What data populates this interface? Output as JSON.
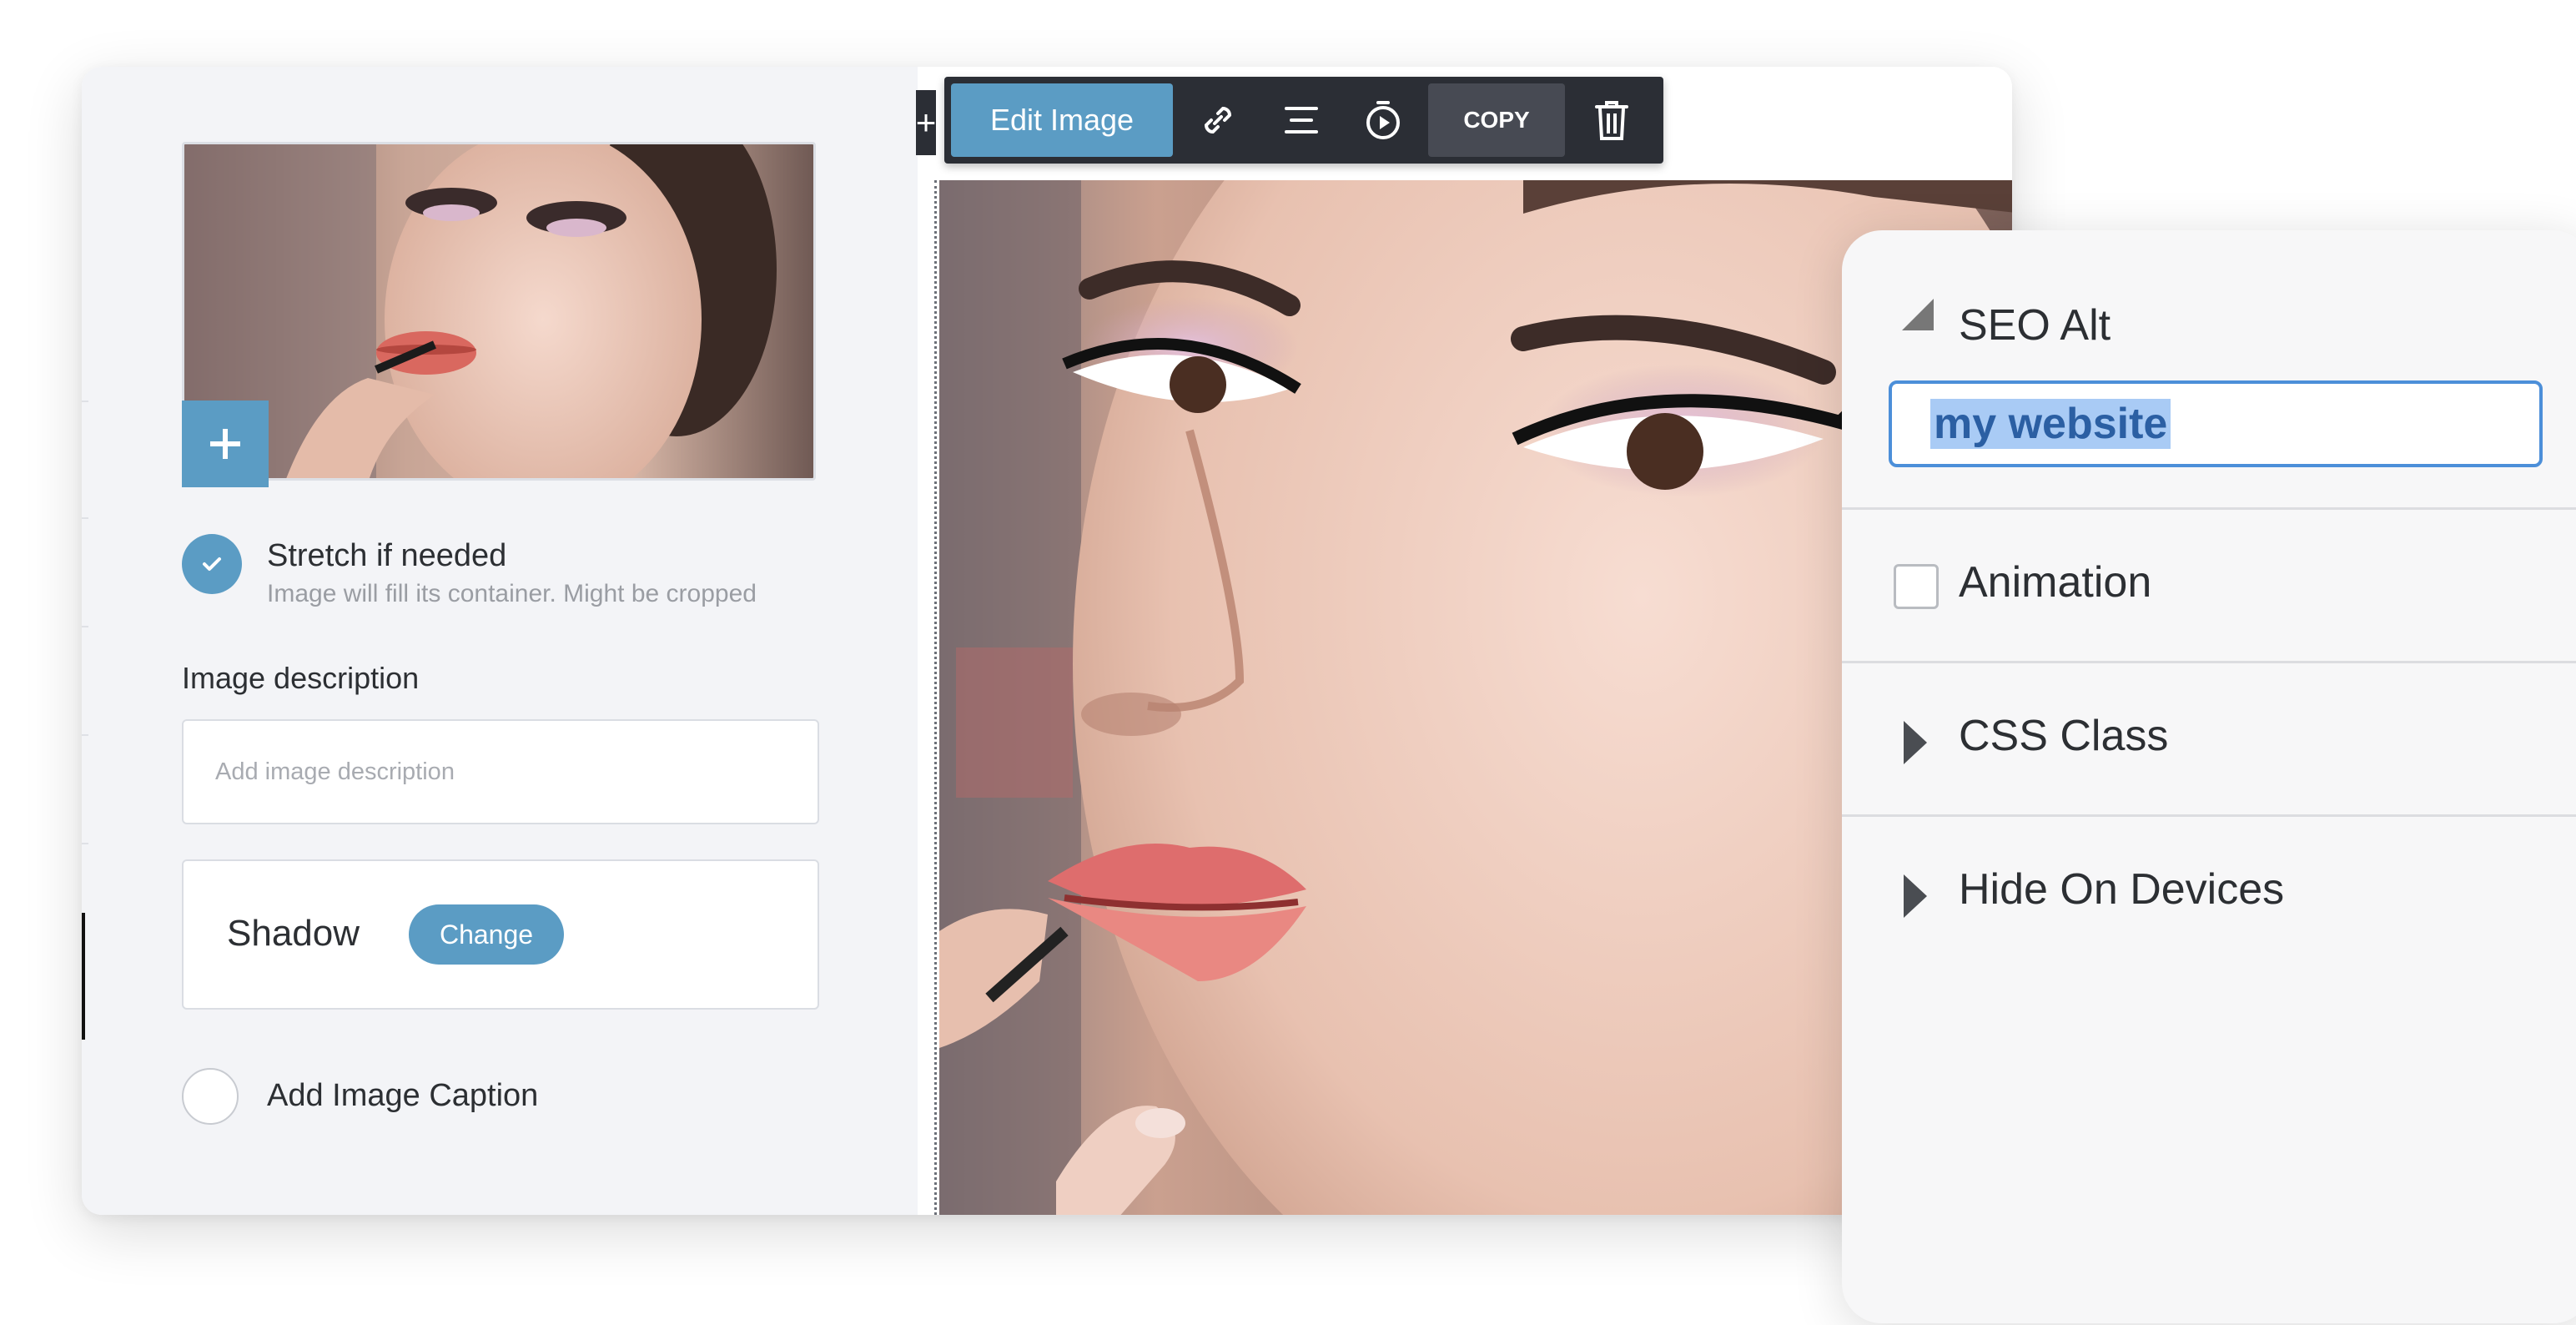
{
  "left_panel": {
    "add_icon": "plus-icon",
    "stretch": {
      "checked": true,
      "label": "Stretch if needed",
      "sublabel": "Image will fill its container. Might be cropped"
    },
    "description": {
      "label": "Image description",
      "placeholder": "Add image description",
      "value": ""
    },
    "shadow": {
      "label": "Shadow",
      "button": "Change"
    },
    "caption": {
      "checked": false,
      "label": "Add Image Caption"
    }
  },
  "toolbar": {
    "plus": "+",
    "edit_image": "Edit Image",
    "icons": [
      "link-icon",
      "align-icon",
      "timer-icon"
    ],
    "copy": "COPY",
    "delete_icon": "trash-icon"
  },
  "seo_panel": {
    "seo_alt": {
      "label": "SEO Alt",
      "value": "my website",
      "expanded": true
    },
    "animation": {
      "label": "Animation",
      "checked": false
    },
    "css_class": {
      "label": "CSS Class",
      "expanded": false
    },
    "hide_on_devices": {
      "label": "Hide On Devices",
      "expanded": false
    }
  },
  "colors": {
    "accent": "#5b9cc4",
    "toolbar": "#2b2e35",
    "focus": "#4c8fd9",
    "selection": "#a9cbf5"
  }
}
